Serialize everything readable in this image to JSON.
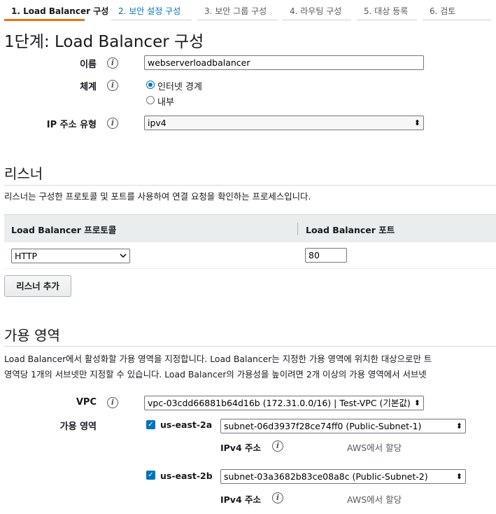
{
  "wizard": {
    "steps": [
      {
        "label": "1. Load Balancer 구성",
        "state": "active"
      },
      {
        "label": "2. 보안 설정 구성",
        "state": "link"
      },
      {
        "label": "3. 보안 그룹 구성",
        "state": "disabled"
      },
      {
        "label": "4. 라우팅 구성",
        "state": "disabled"
      },
      {
        "label": "5. 대상 등록",
        "state": "disabled"
      },
      {
        "label": "6. 검토",
        "state": "disabled"
      }
    ]
  },
  "page_title": "1단계: Load Balancer 구성",
  "basic": {
    "name_label": "이름",
    "name_value": "webserverloadbalancer",
    "scheme_label": "체계",
    "scheme_options": [
      "인터넷 경계",
      "내부"
    ],
    "scheme_selected": "인터넷 경계",
    "ip_type_label": "IP 주소 유형",
    "ip_type_value": "ipv4"
  },
  "listeners": {
    "title": "리스너",
    "description": "리스너는 구성한 프로토콜 및 포트를 사용하여 연결 요청을 확인하는 프로세스입니다.",
    "columns": [
      "Load Balancer 프로토콜",
      "Load Balancer 포트"
    ],
    "rows": [
      {
        "protocol": "HTTP",
        "port": "80"
      }
    ],
    "add_button": "리스너 추가"
  },
  "availability_zones": {
    "title": "가용 영역",
    "description_line1": "Load Balancer에서 활성화할 가용 영역을 지정합니다. Load Balancer는 지정한 가용 영역에 위치한 대상으로만 트",
    "description_line2": "영역당 1개의 서브넷만 지정할 수 있습니다. Load Balancer의 가용성을 높이려면 2개 이상의 가용 영역에서 서브넷",
    "vpc_label": "VPC",
    "vpc_value": "vpc-03cdd66881b64d16b (172.31.0.0/16) | Test-VPC (기본값)",
    "zones_label": "가용 영역",
    "zones": [
      {
        "name": "us-east-2a",
        "checked": true,
        "subnet": "subnet-06d3937f28ce74ff0 (Public-Subnet-1)",
        "ipv4_label": "IPv4 주소",
        "ipv4_value": "AWS에서 할당"
      },
      {
        "name": "us-east-2b",
        "checked": true,
        "subnet": "subnet-03a3682b83ce08a8c (Public-Subnet-2)",
        "ipv4_label": "IPv4 주소",
        "ipv4_value": "AWS에서 할당"
      }
    ]
  },
  "icons": {
    "info": "i",
    "select_arrow": "⬍",
    "checkmark": "✓"
  },
  "colors": {
    "accent": "#ec7211",
    "link": "#0073bb",
    "text": "#16191f"
  }
}
